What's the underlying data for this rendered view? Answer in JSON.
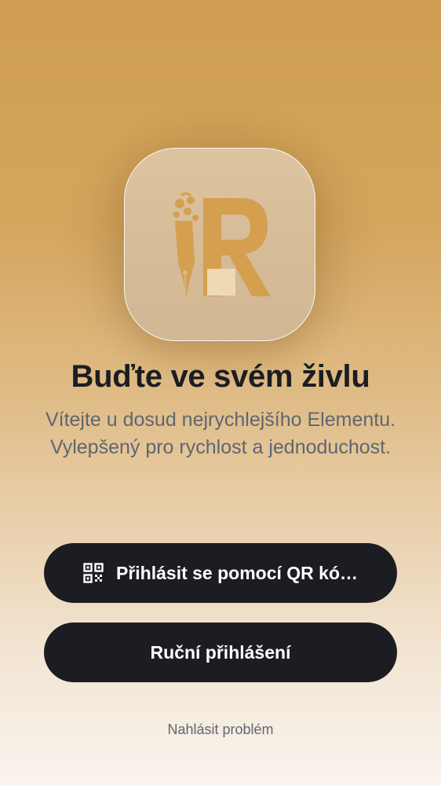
{
  "welcome": {
    "headline": "Buďte ve svém živlu",
    "subtitle_line1": "Vítejte u dosud nejrychlejšího Elementu.",
    "subtitle_line2": "Vylepšený pro rychlost a jednoduchost."
  },
  "actions": {
    "qr_login_label": "Přihlásit se pomocí QR kó…",
    "qr_icon": "qr-code-icon",
    "manual_login_label": "Ruční přihlášení",
    "report_problem_label": "Nahlásit problém"
  },
  "colors": {
    "accent": "#D49F4F",
    "button": "#1C1D22",
    "headline": "#1C1D22",
    "muted_text": "#5F6670"
  }
}
